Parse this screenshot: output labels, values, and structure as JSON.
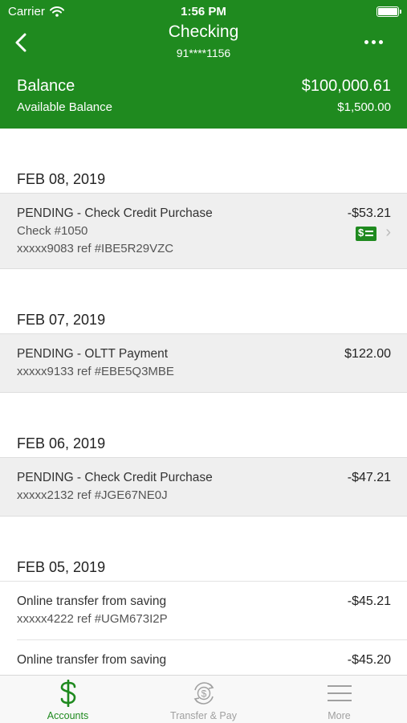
{
  "status_bar": {
    "carrier": "Carrier",
    "time": "1:56 PM"
  },
  "nav": {
    "title": "Checking",
    "account_number": "91****1156"
  },
  "balance": {
    "label": "Balance",
    "value": "$100,000.61",
    "available_label": "Available Balance",
    "available_value": "$1,500.00"
  },
  "groups": [
    {
      "date": "FEB 08, 2019",
      "transactions": [
        {
          "desc": "PENDING - Check Credit Purchase",
          "line2": "Check #1050",
          "line3": "xxxxx9083 ref #IBE5R29VZC",
          "amount": "-$53.21",
          "icon": "check-image-icon"
        }
      ]
    },
    {
      "date": "FEB 07, 2019",
      "transactions": [
        {
          "desc": "PENDING - OLTT Payment",
          "line2": "xxxxx9133 ref #EBE5Q3MBE",
          "amount": "$122.00"
        }
      ]
    },
    {
      "date": "FEB 06, 2019",
      "transactions": [
        {
          "desc": "PENDING - Check Credit Purchase",
          "line2": "xxxxx2132 ref #JGE67NE0J",
          "amount": "-$47.21"
        }
      ]
    },
    {
      "date": "FEB 05, 2019",
      "transactions": [
        {
          "desc": "Online transfer from saving",
          "line2": "xxxxx4222 ref #UGM673I2P",
          "amount": "-$45.21"
        },
        {
          "desc": "Online transfer from saving",
          "amount": "-$45.20"
        }
      ]
    }
  ],
  "tabs": [
    {
      "label": "Accounts",
      "icon": "dollar-icon",
      "active": true
    },
    {
      "label": "Transfer & Pay",
      "icon": "transfer-pay-icon",
      "active": false
    },
    {
      "label": "More",
      "icon": "menu-icon",
      "active": false
    }
  ],
  "colors": {
    "brand": "#1f8a1f",
    "pending_bg": "#efefef",
    "inactive_tab": "#a0a0a0"
  }
}
